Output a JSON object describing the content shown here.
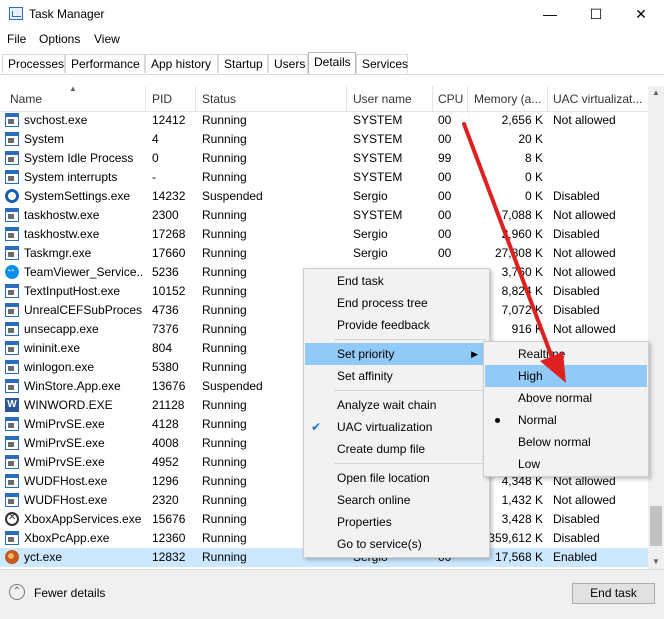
{
  "window": {
    "title": "Task Manager",
    "minimize": "—",
    "maximize": "☐",
    "close": "✕"
  },
  "menu": [
    "File",
    "Options",
    "View"
  ],
  "tabs": [
    "Processes",
    "Performance",
    "App history",
    "Startup",
    "Users",
    "Details",
    "Services"
  ],
  "active_tab": "Details",
  "columns": [
    "Name",
    "PID",
    "Status",
    "User name",
    "CPU",
    "Memory (a...",
    "UAC virtualizat..."
  ],
  "rows": [
    {
      "icon": "win",
      "name": "svchost.exe",
      "pid": "12412",
      "status": "Running",
      "user": "SYSTEM",
      "cpu": "00",
      "mem": "2,656 K",
      "uac": "Not allowed"
    },
    {
      "icon": "win",
      "name": "System",
      "pid": "4",
      "status": "Running",
      "user": "SYSTEM",
      "cpu": "00",
      "mem": "20 K",
      "uac": ""
    },
    {
      "icon": "win",
      "name": "System Idle Process",
      "pid": "0",
      "status": "Running",
      "user": "SYSTEM",
      "cpu": "99",
      "mem": "8 K",
      "uac": ""
    },
    {
      "icon": "win",
      "name": "System interrupts",
      "pid": "-",
      "status": "Running",
      "user": "SYSTEM",
      "cpu": "00",
      "mem": "0 K",
      "uac": ""
    },
    {
      "icon": "gear",
      "name": "SystemSettings.exe",
      "pid": "14232",
      "status": "Suspended",
      "user": "Sergio",
      "cpu": "00",
      "mem": "0 K",
      "uac": "Disabled"
    },
    {
      "icon": "win",
      "name": "taskhostw.exe",
      "pid": "2300",
      "status": "Running",
      "user": "SYSTEM",
      "cpu": "00",
      "mem": "7,088 K",
      "uac": "Not allowed"
    },
    {
      "icon": "win",
      "name": "taskhostw.exe",
      "pid": "17268",
      "status": "Running",
      "user": "Sergio",
      "cpu": "00",
      "mem": "2,960 K",
      "uac": "Disabled"
    },
    {
      "icon": "win",
      "name": "Taskmgr.exe",
      "pid": "17660",
      "status": "Running",
      "user": "Sergio",
      "cpu": "00",
      "mem": "27,808 K",
      "uac": "Not allowed"
    },
    {
      "icon": "tv",
      "name": "TeamViewer_Service....",
      "pid": "5236",
      "status": "Running",
      "user": "",
      "cpu": "",
      "mem": "3,760 K",
      "uac": "Not allowed"
    },
    {
      "icon": "win",
      "name": "TextInputHost.exe",
      "pid": "10152",
      "status": "Running",
      "user": "",
      "cpu": "",
      "mem": "8,824 K",
      "uac": "Disabled"
    },
    {
      "icon": "win",
      "name": "UnrealCEFSubProces...",
      "pid": "4736",
      "status": "Running",
      "user": "",
      "cpu": "",
      "mem": "7,072 K",
      "uac": "Disabled"
    },
    {
      "icon": "win",
      "name": "unsecapp.exe",
      "pid": "7376",
      "status": "Running",
      "user": "",
      "cpu": "",
      "mem": "916 K",
      "uac": "Not allowed"
    },
    {
      "icon": "win",
      "name": "wininit.exe",
      "pid": "804",
      "status": "Running",
      "user": "",
      "cpu": "",
      "mem": "",
      "uac": ""
    },
    {
      "icon": "win",
      "name": "winlogon.exe",
      "pid": "5380",
      "status": "Running",
      "user": "",
      "cpu": "",
      "mem": "",
      "uac": ""
    },
    {
      "icon": "win",
      "name": "WinStore.App.exe",
      "pid": "13676",
      "status": "Suspended",
      "user": "",
      "cpu": "",
      "mem": "",
      "uac": ""
    },
    {
      "icon": "word",
      "name": "WINWORD.EXE",
      "pid": "21128",
      "status": "Running",
      "user": "",
      "cpu": "",
      "mem": "",
      "uac": ""
    },
    {
      "icon": "win",
      "name": "WmiPrvSE.exe",
      "pid": "4128",
      "status": "Running",
      "user": "",
      "cpu": "",
      "mem": "",
      "uac": ""
    },
    {
      "icon": "win",
      "name": "WmiPrvSE.exe",
      "pid": "4008",
      "status": "Running",
      "user": "",
      "cpu": "",
      "mem": "",
      "uac": ""
    },
    {
      "icon": "win",
      "name": "WmiPrvSE.exe",
      "pid": "4952",
      "status": "Running",
      "user": "",
      "cpu": "",
      "mem": "",
      "uac": ""
    },
    {
      "icon": "win",
      "name": "WUDFHost.exe",
      "pid": "1296",
      "status": "Running",
      "user": "",
      "cpu": "",
      "mem": "4,348 K",
      "uac": "Not allowed"
    },
    {
      "icon": "win",
      "name": "WUDFHost.exe",
      "pid": "2320",
      "status": "Running",
      "user": "",
      "cpu": "",
      "mem": "1,432 K",
      "uac": "Not allowed"
    },
    {
      "icon": "xbox",
      "name": "XboxAppServices.exe",
      "pid": "15676",
      "status": "Running",
      "user": "",
      "cpu": "",
      "mem": "3,428 K",
      "uac": "Disabled"
    },
    {
      "icon": "win",
      "name": "XboxPcApp.exe",
      "pid": "12360",
      "status": "Running",
      "user": "",
      "cpu": "",
      "mem": "359,612 K",
      "uac": "Disabled"
    },
    {
      "icon": "yct",
      "name": "yct.exe",
      "pid": "12832",
      "status": "Running",
      "user": "Sergio",
      "cpu": "00",
      "mem": "17,568 K",
      "uac": "Enabled"
    }
  ],
  "selected_row": 23,
  "context_menu": {
    "end_task": "End task",
    "end_tree": "End process tree",
    "feedback": "Provide feedback",
    "set_priority": "Set priority",
    "set_affinity": "Set affinity",
    "analyze": "Analyze wait chain",
    "uac": "UAC virtualization",
    "dump": "Create dump file",
    "open_location": "Open file location",
    "search": "Search online",
    "properties": "Properties",
    "goto_service": "Go to service(s)",
    "uac_checked": true
  },
  "priority_menu": {
    "items": [
      "Realtime",
      "High",
      "Above normal",
      "Normal",
      "Below normal",
      "Low"
    ],
    "highlighted": "High",
    "selected": "Normal"
  },
  "footer": {
    "fewer_details": "Fewer details",
    "end_task": "End task"
  },
  "colors": {
    "selection": "#cce8ff",
    "menu_highlight": "#91c9f7",
    "annotation_arrow": "#e02020"
  }
}
